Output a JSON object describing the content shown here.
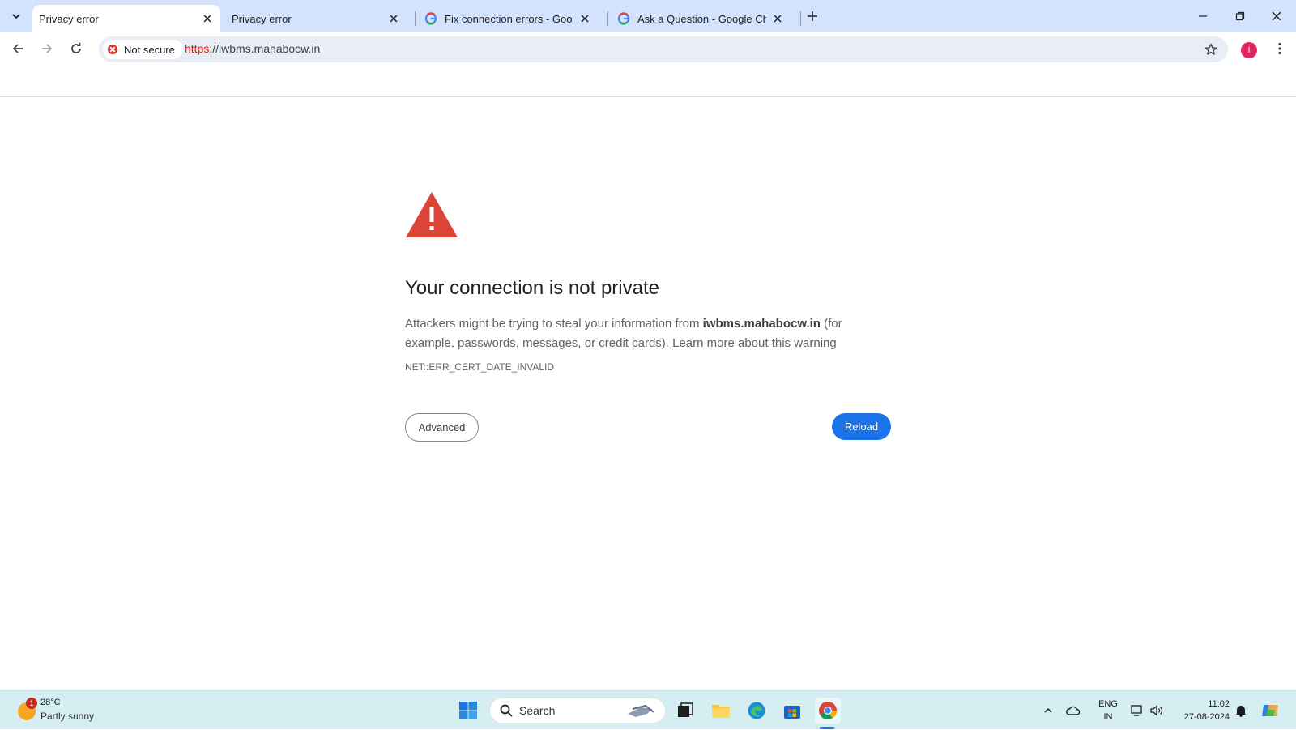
{
  "tabs": [
    {
      "title": "Privacy error",
      "active": true,
      "icon": "warning-icon"
    },
    {
      "title": "Privacy error",
      "active": false,
      "icon": "warning-icon"
    },
    {
      "title": "Fix connection errors - Google Chrome Help",
      "active": false,
      "icon": "google-g-icon"
    },
    {
      "title": "Ask a Question - Google Chrome Community",
      "active": false,
      "icon": "google-g-icon"
    }
  ],
  "omnibox": {
    "security_label": "Not secure",
    "url_scheme": "https",
    "url_rest": "://iwbms.mahabocw.in"
  },
  "profile": {
    "initial": "I",
    "color": "#e0245e"
  },
  "interstitial": {
    "heading": "Your connection is not private",
    "desc_before": "Attackers might be trying to steal your information from ",
    "domain": "iwbms.mahabocw.in",
    "desc_after": " (for example, passwords, messages, or credit cards). ",
    "learn_more": "Learn more about this warning",
    "error_code": "NET::ERR_CERT_DATE_INVALID",
    "advanced_label": "Advanced",
    "reload_label": "Reload"
  },
  "taskbar": {
    "weather_temp": "28°C",
    "weather_condition": "Partly sunny",
    "weather_badge": "1",
    "search_label": "Search",
    "lang_line1": "ENG",
    "lang_line2": "IN",
    "time": "11:02",
    "date": "27-08-2024"
  },
  "colors": {
    "tabstrip": "#d3e3fd",
    "accent": "#1a73e8",
    "warning": "#db4437",
    "insecure": "#d93025",
    "taskbar": "#d4eef2"
  }
}
